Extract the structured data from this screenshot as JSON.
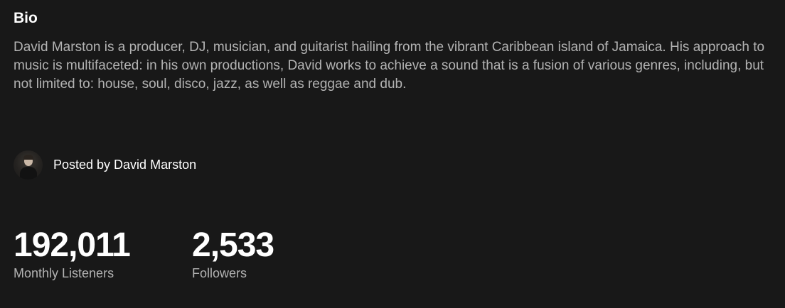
{
  "bio": {
    "heading": "Bio",
    "text": "David Marston is a producer, DJ, musician, and guitarist hailing from the vibrant Caribbean island of Jamaica. His approach to music is multifaceted: in his own productions, David works to achieve a sound that is a fusion of various genres, including, but not limited to: house, soul, disco, jazz, as well as reggae and dub."
  },
  "posted": {
    "label": "Posted by David Marston",
    "avatar_icon": "artist-avatar"
  },
  "stats": {
    "monthly_listeners": {
      "value": "192,011",
      "label": "Monthly Listeners"
    },
    "followers": {
      "value": "2,533",
      "label": "Followers"
    }
  },
  "colors": {
    "background": "#181818",
    "primary_text": "#ffffff",
    "secondary_text": "#b3b3b3"
  }
}
